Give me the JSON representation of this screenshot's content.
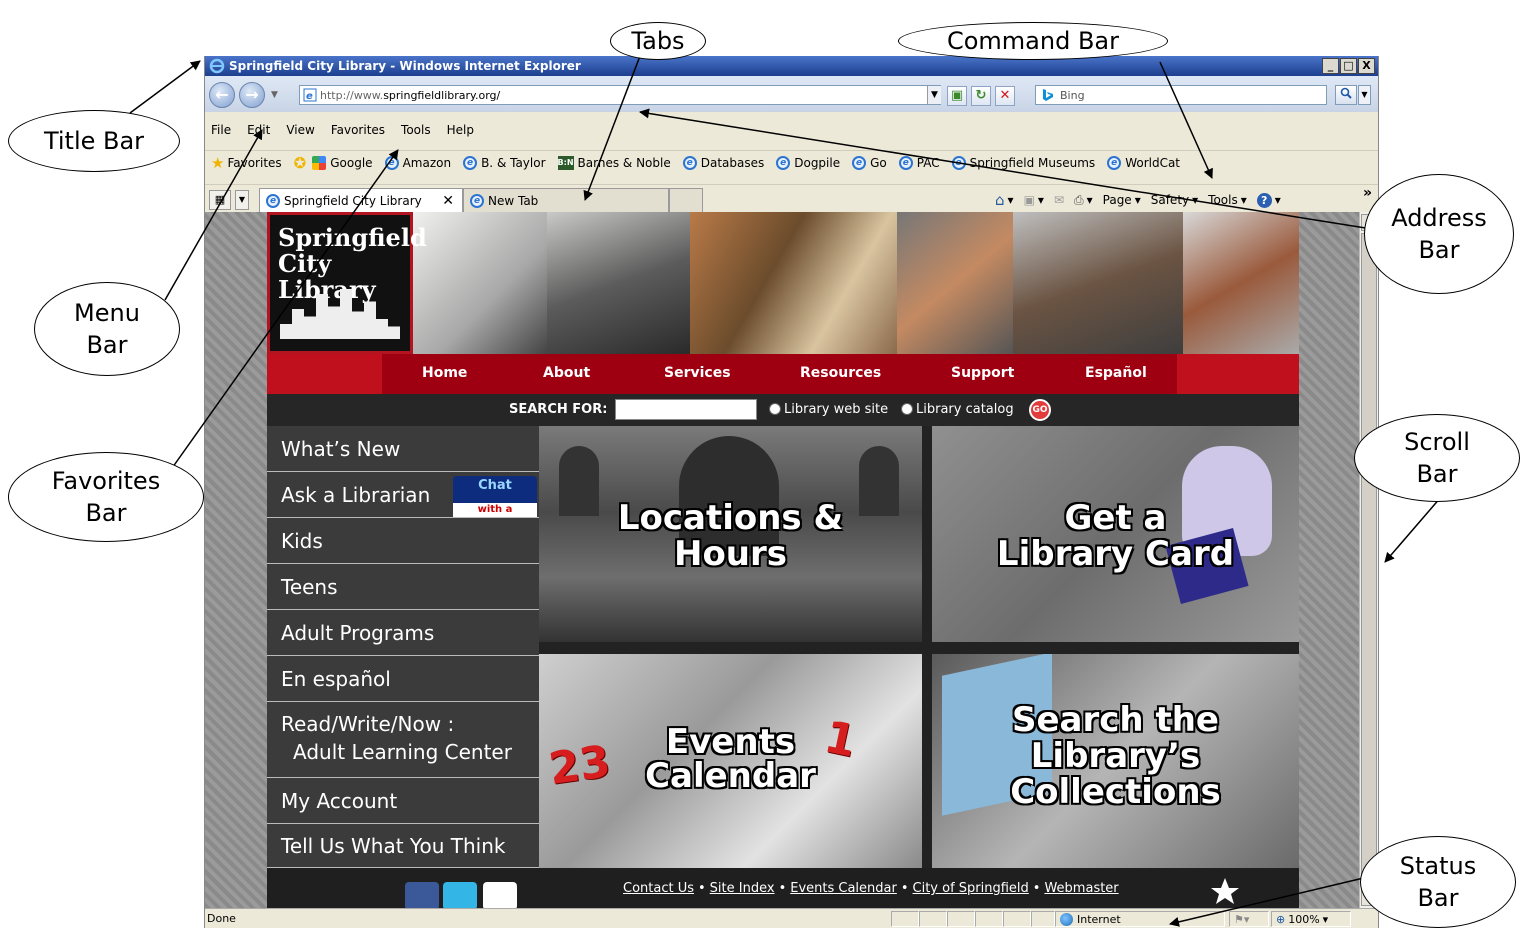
{
  "window": {
    "title": "Springfield City Library - Windows Internet Explorer",
    "controls": [
      "_",
      "□",
      "X"
    ]
  },
  "address": {
    "url_prefix": "http://www.",
    "url_domain": "springfieldlibrary.org/",
    "dropdown": "▼"
  },
  "search": {
    "placeholder": "Bing",
    "button": "⌕"
  },
  "menu": [
    "File",
    "Edit",
    "View",
    "Favorites",
    "Tools",
    "Help"
  ],
  "favorites_bar": {
    "label": "Favorites",
    "items": [
      "Google",
      "Amazon",
      "B. & Taylor",
      "Barnes & Noble",
      "Databases",
      "Dogpile",
      "Go",
      "PAC",
      "Springfield Museums",
      "WorldCat"
    ]
  },
  "tabs": [
    {
      "label": "Springfield City Library",
      "close": "✕"
    },
    {
      "label": "New Tab"
    }
  ],
  "command_bar": {
    "items": [
      "Page",
      "Safety",
      "Tools"
    ],
    "more": "»"
  },
  "site": {
    "logo_line1": "Springfield",
    "logo_line2": "City Library",
    "nav": [
      "Home",
      "About",
      "Services",
      "Resources",
      "Support",
      "Español"
    ],
    "search_label": "SEARCH FOR:",
    "radio_site": "Library web site",
    "radio_catalog": "Library catalog",
    "go": "GO",
    "side_menu": [
      "What’s New",
      "Ask a Librarian",
      "Kids",
      "Teens",
      "Adult Programs",
      "En español",
      "Read/Write/Now :",
      "My Account",
      "Tell Us What You Think"
    ],
    "side_menu_sub": "Adult Learning Center",
    "chat_badge": "Chat",
    "chat_badge_sub": "with a librarian",
    "tiles": {
      "locations_1": "Locations &",
      "locations_2": "Hours",
      "card_1": "Get a",
      "card_2": "Library Card",
      "events_1": "Events",
      "events_2": "Calendar",
      "collections_1": "Search the",
      "collections_2": "Library’s",
      "collections_3": "Collections"
    },
    "footer_links": [
      "Contact Us",
      "Site Index",
      "Events Calendar",
      "City of Springfield",
      "Webmaster"
    ],
    "footer_sep": "•"
  },
  "status": {
    "text": "Done",
    "zone": "Internet",
    "zoom": "100%"
  },
  "callouts": {
    "title_bar": "Title Bar",
    "tabs": "Tabs",
    "command_bar": "Command Bar",
    "address_bar_1": "Address",
    "address_bar_2": "Bar",
    "menu_bar_1": "Menu",
    "menu_bar_2": "Bar",
    "favorites_bar_1": "Favorites",
    "favorites_bar_2": "Bar",
    "scroll_bar_1": "Scroll",
    "scroll_bar_2": "Bar",
    "status_bar_1": "Status",
    "status_bar_2": "Bar"
  }
}
